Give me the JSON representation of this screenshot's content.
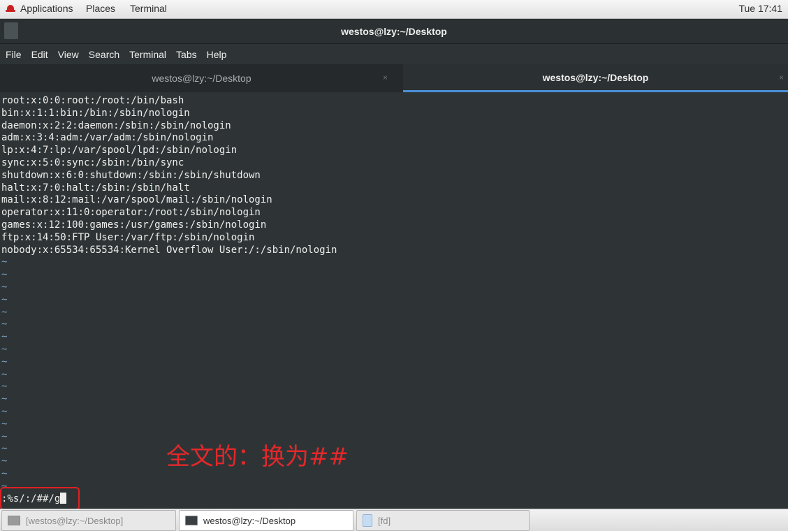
{
  "top_panel": {
    "applications": "Applications",
    "places": "Places",
    "terminal": "Terminal",
    "clock": "Tue 17:41"
  },
  "window": {
    "title": "westos@lzy:~/Desktop"
  },
  "menubar": {
    "items": [
      "File",
      "Edit",
      "View",
      "Search",
      "Terminal",
      "Tabs",
      "Help"
    ]
  },
  "tabs": [
    {
      "label": "westos@lzy:~/Desktop",
      "close": "×",
      "active": false
    },
    {
      "label": "westos@lzy:~/Desktop",
      "close": "×",
      "active": true
    }
  ],
  "terminal": {
    "lines": [
      "root:x:0:0:root:/root:/bin/bash",
      "bin:x:1:1:bin:/bin:/sbin/nologin",
      "daemon:x:2:2:daemon:/sbin:/sbin/nologin",
      "adm:x:3:4:adm:/var/adm:/sbin/nologin",
      "lp:x:4:7:lp:/var/spool/lpd:/sbin/nologin",
      "sync:x:5:0:sync:/sbin:/bin/sync",
      "shutdown:x:6:0:shutdown:/sbin:/sbin/shutdown",
      "halt:x:7:0:halt:/sbin:/sbin/halt",
      "mail:x:8:12:mail:/var/spool/mail:/sbin/nologin",
      "operator:x:11:0:operator:/root:/sbin/nologin",
      "games:x:12:100:games:/usr/games:/sbin/nologin",
      "ftp:x:14:50:FTP User:/var/ftp:/sbin/nologin",
      "nobody:x:65534:65534:Kernel Overflow User:/:/sbin/nologin"
    ],
    "tilde": "~",
    "command": ":%s/:/##/g",
    "annotation": "全文的：换为##"
  },
  "taskbar": {
    "items": [
      "[westos@lzy:~/Desktop]",
      "westos@lzy:~/Desktop",
      "[fd]"
    ]
  }
}
